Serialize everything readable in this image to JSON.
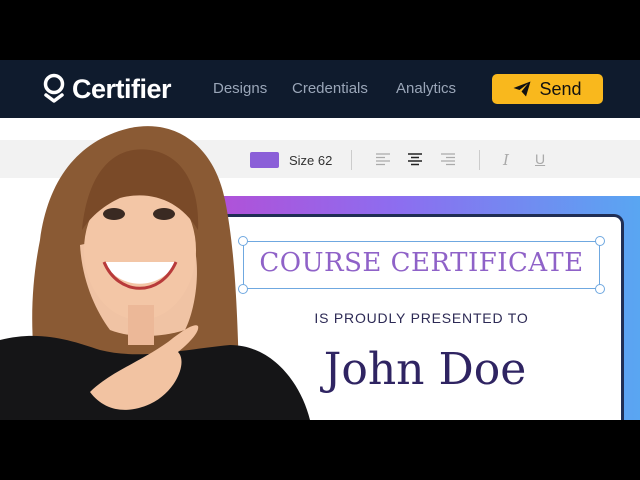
{
  "app": {
    "name": "Certifier"
  },
  "nav": {
    "links": [
      {
        "label": "Designs"
      },
      {
        "label": "Credentials"
      },
      {
        "label": "Analytics"
      }
    ],
    "send_label": "Send"
  },
  "toolbar": {
    "font_color": "#8b5fd8",
    "size_label": "Size 62",
    "alignment": "center",
    "italic_label": "I",
    "underline_label": "U"
  },
  "certificate": {
    "title": "COURSE CERTIFICATE",
    "subtitle": "IS PROUDLY PRESENTED TO",
    "recipient": "John Doe"
  },
  "colors": {
    "navbar": "#0f1b2d",
    "send_button": "#f9b81d",
    "title": "#8f62c8",
    "name": "#2f2462",
    "frame_gradient_start": "#b34fd6",
    "frame_gradient_end": "#59a6f2"
  }
}
